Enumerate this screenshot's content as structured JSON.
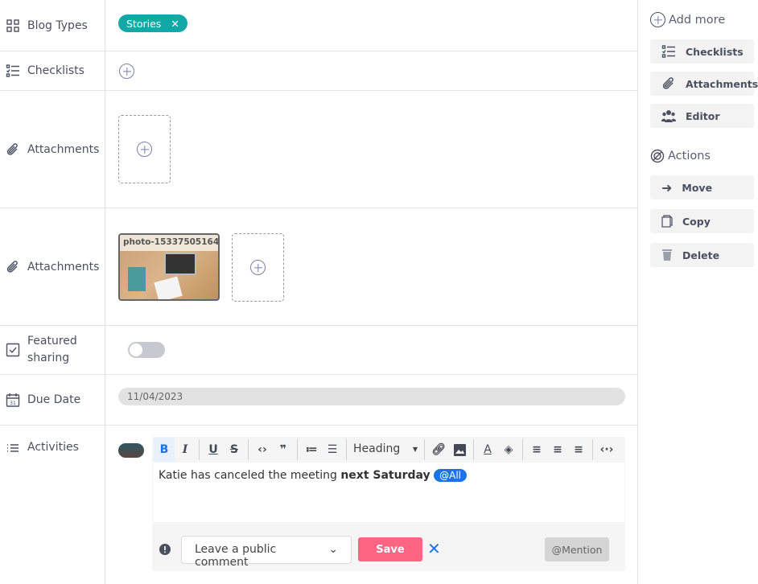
{
  "fields": {
    "blog_types": {
      "label": "Blog Types",
      "tags": [
        "Stories"
      ]
    },
    "checklists": {
      "label": "Checklists"
    },
    "attachments_empty": {
      "label": "Attachments"
    },
    "attachments": {
      "label": "Attachments",
      "files": [
        "photo-153375051645..."
      ]
    },
    "featured_sharing": {
      "label": "Featured sharing",
      "enabled": false
    },
    "due_date": {
      "label": "Due Date",
      "value": "11/04/2023"
    },
    "activities": {
      "label": "Activities"
    }
  },
  "editor": {
    "heading_select": "Heading",
    "content_plain": "Katie has canceled the meeting ",
    "content_bold": "next Saturday",
    "mention_tag": "@All",
    "visibility_select": "Leave a public comment",
    "save_label": "Save",
    "mention_label": "@Mention"
  },
  "sidebar": {
    "add_more_title": "Add more",
    "add_more": [
      {
        "label": "Checklists",
        "icon": "checklist-icon"
      },
      {
        "label": "Attachments",
        "icon": "paperclip-icon"
      },
      {
        "label": "Editor",
        "icon": "users-icon"
      }
    ],
    "actions_title": "Actions",
    "actions": [
      {
        "label": "Move",
        "icon": "arrow-right-icon"
      },
      {
        "label": "Copy",
        "icon": "copy-icon"
      },
      {
        "label": "Delete",
        "icon": "trash-icon"
      }
    ]
  },
  "colors": {
    "tag": "#13a8a8",
    "save": "#fe6583",
    "accent": "#1a73e8"
  }
}
